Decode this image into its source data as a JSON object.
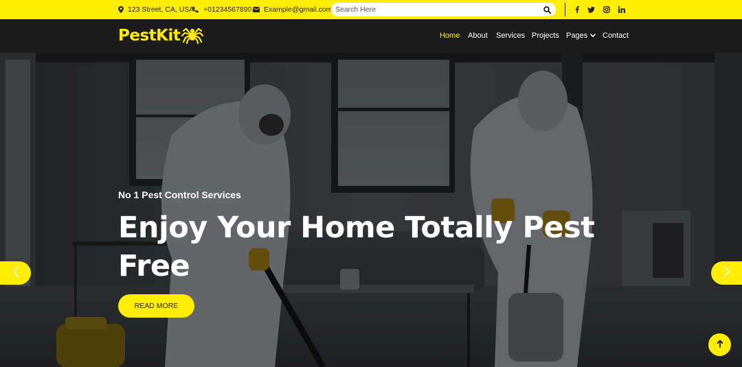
{
  "topbar": {
    "address": "123 Street, CA, USA",
    "phone": "+01234567890",
    "email": "Example@gmail.com",
    "search_placeholder": "Search Here",
    "social": [
      "facebook-icon",
      "twitter-icon",
      "instagram-icon",
      "linkedin-icon"
    ]
  },
  "brand": {
    "name": "PestKit",
    "accent": "#ffee02"
  },
  "nav": {
    "home": "Home",
    "about": "About",
    "services": "Services",
    "projects": "Projects",
    "pages": "Pages",
    "contact": "Contact"
  },
  "hero": {
    "subtitle": "No 1 Pest Control Services",
    "title": "Enjoy Your Home Totally Pest Free",
    "button": "READ MORE"
  },
  "colors": {
    "accent": "#ffee02",
    "navbar": "#1c1c1c",
    "text": "#ffffff"
  }
}
